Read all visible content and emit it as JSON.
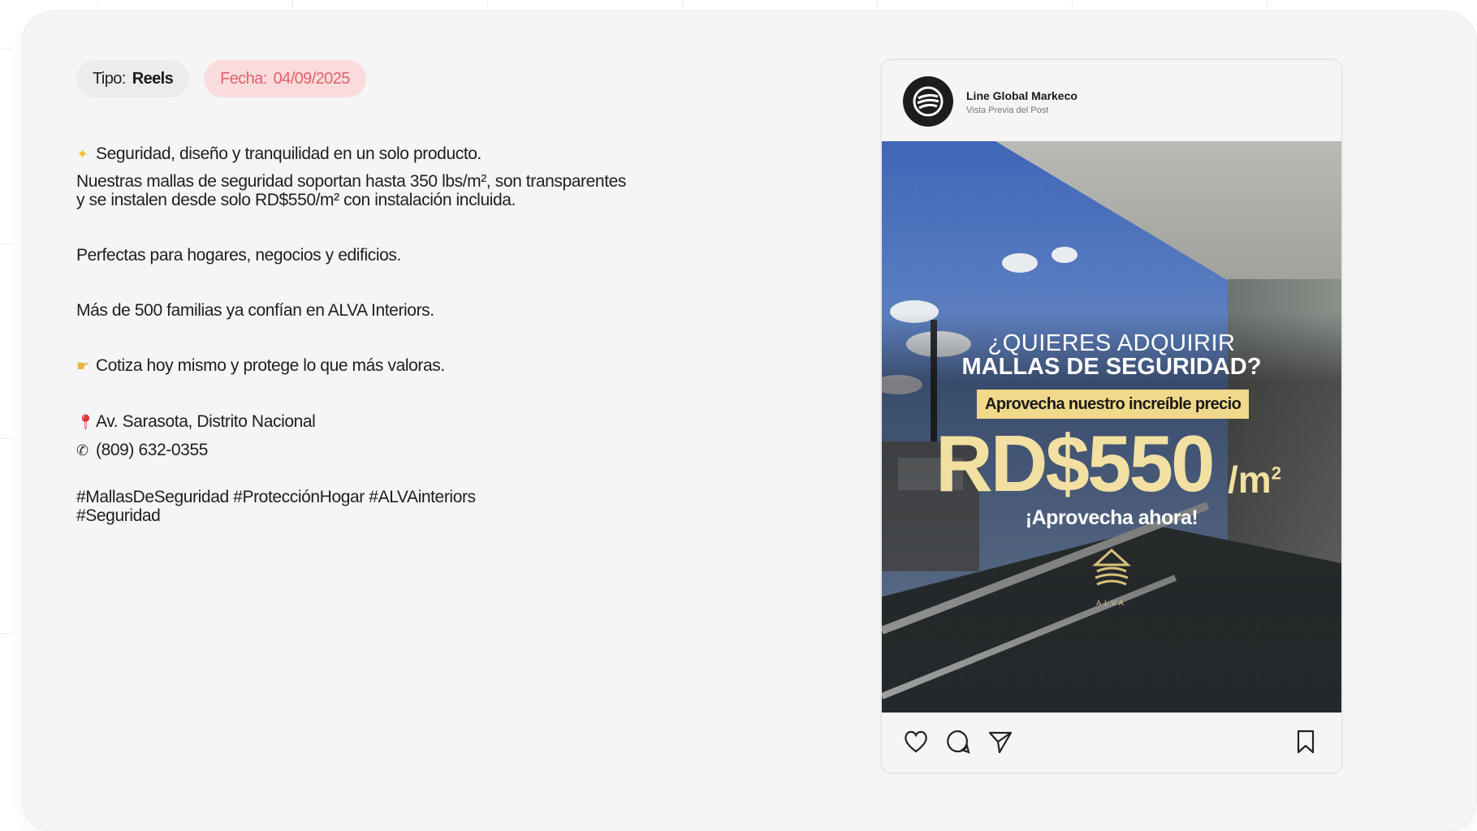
{
  "post": {
    "type_label": "Tipo:",
    "type_value": "Reels",
    "date_label": "Fecha:",
    "date_value": "04/09/2025"
  },
  "caption": {
    "line1": "Seguridad, diseño y tranquilidad en un solo producto.",
    "line2": "Nuestras mallas de seguridad soportan hasta 350 lbs/m², son transparentes y se instalen desde solo RD$550/m² con instalación incluida.",
    "line3": "Perfectas para hogares, negocios y edificios.",
    "line4": "Más de 500 familias ya confían en ALVA Interiors.",
    "line5": "Cotiza hoy mismo y protege lo que más valoras.",
    "address": "Av. Sarasota, Distrito Nacional",
    "phone": "(809) 632-0355",
    "hashtags": "#MallasDeSeguridad #ProtecciónHogar #ALVAinteriors #Seguridad"
  },
  "preview": {
    "account_name": "Line Global Markeco",
    "account_sub": "Vista Previa del Post",
    "headline_1": "¿QUIERES ADQUIRIR",
    "headline_2": "MALLAS DE SEGURIDAD?",
    "badge": "Aprovecha nuestro increíble precio",
    "price": "RD$550",
    "unit": "/m",
    "unit_sup": "2",
    "cta": "¡Aprovecha ahora!",
    "brand": "ALVA"
  },
  "icons": {
    "like": "heart-icon",
    "comment": "comment-icon",
    "share": "send-icon",
    "save": "bookmark-icon",
    "bullet1": "sparkle-icon",
    "bullet2": "pointing-hand-icon",
    "bullet3": "pin-icon",
    "bullet4": "phone-icon"
  },
  "colors": {
    "card_bg": "#f5f5f5",
    "date_tag_bg": "#fbdcdc",
    "date_tag_text": "#e0626b",
    "price_gold": "#f2e0a2",
    "badge_bg": "#f0d98a"
  }
}
